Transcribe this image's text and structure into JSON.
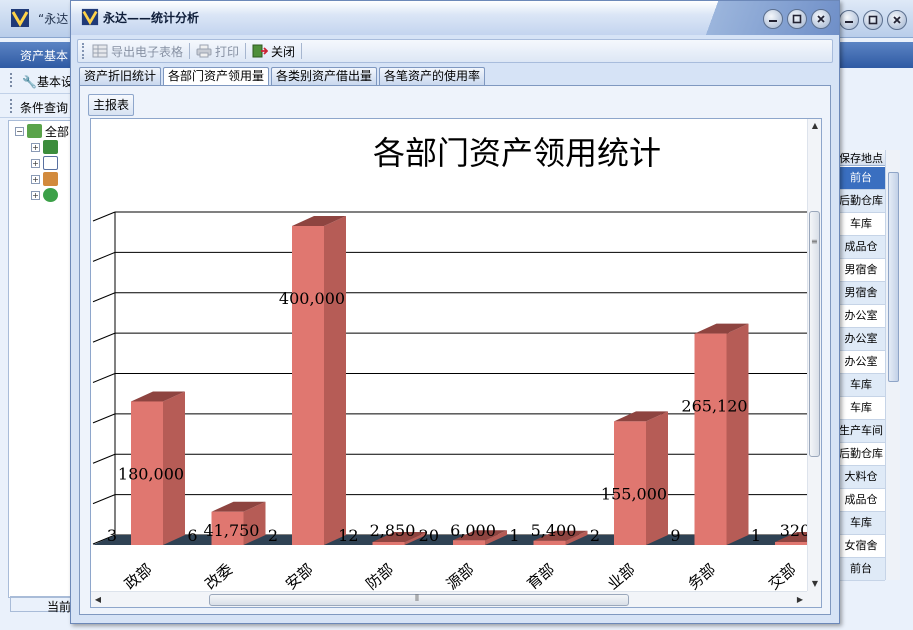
{
  "background_window": {
    "title": "“永达",
    "nav_label": "资产基本",
    "toolbar_basic": "基本设",
    "toolbar_query": "条件查询",
    "tree_root": "全部",
    "status_text": "当前",
    "right_column": {
      "header": "保存地点",
      "cells": [
        "前台",
        "后勤仓库",
        "车库",
        "成品仓",
        "男宿舍",
        "男宿舍",
        "办公室",
        "办公室",
        "办公室",
        "车库",
        "车库",
        "生产车间",
        "后勤仓库",
        "大料仓",
        "成品仓",
        "车库",
        "女宿舍",
        "前台"
      ]
    }
  },
  "dialog": {
    "title": "永达——统计分析",
    "toolbar": {
      "export_label": "导出电子表格",
      "print_label": "打印",
      "close_label": "关闭"
    },
    "tabs": [
      "资产折旧统计",
      "各部门资产领用量",
      "各类别资产借出量",
      "各笔资产的使用率"
    ],
    "active_tab": 1,
    "inner_tab_label": "主报表",
    "hscroll_grip": "⦀",
    "vscroll_grip": "≡"
  },
  "colors": {
    "bar_front": "#e07770",
    "bar_side": "#b65c56",
    "bar_top": "#8e4440",
    "floor": "#2f4254"
  },
  "chart_data": {
    "type": "bar",
    "title": "各部门资产领用统计",
    "categories": [
      "行政部",
      "企改委",
      "保安部",
      "消防部",
      "资源部",
      "体育部",
      "企业部",
      "服务部",
      "外交部"
    ],
    "category_display": [
      "政部",
      "改委",
      "安部",
      "防部",
      "源部",
      "育部",
      "业部",
      "务部",
      "交部"
    ],
    "values": [
      180000,
      41750,
      400000,
      2850,
      6000,
      5400,
      155000,
      265120,
      320
    ],
    "value_labels": [
      "180,000",
      "41,750",
      "400,000",
      "2,850",
      "6,000",
      "5,400",
      "155,000",
      "265,120",
      "320"
    ],
    "count_labels": [
      "3",
      "6",
      "2",
      "12",
      "20",
      "1",
      "2",
      "9",
      "1"
    ],
    "grid": true,
    "ylim": [
      0,
      400000
    ]
  }
}
